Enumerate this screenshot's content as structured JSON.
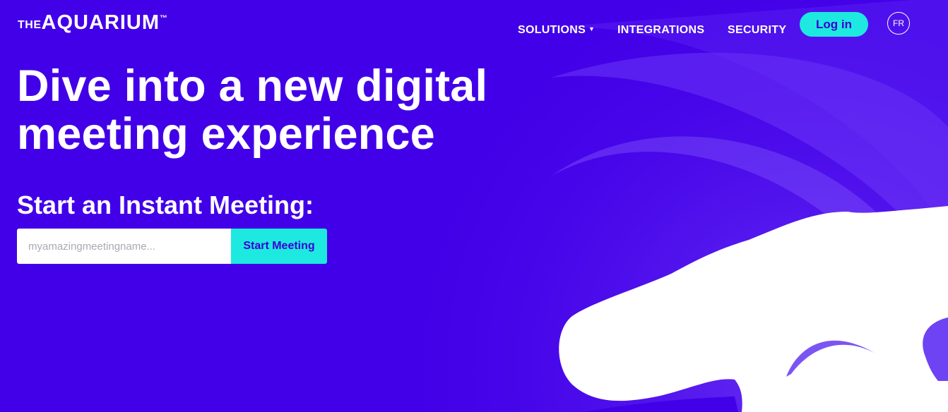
{
  "colors": {
    "background": "#4200e8",
    "accent": "#1de9e0",
    "accent_text": "#3a00d6",
    "text": "#ffffff"
  },
  "header": {
    "logo": {
      "prefix": "THE",
      "name": "AQUARIUM",
      "trademark": "™"
    },
    "nav": {
      "solutions": "SOLUTIONS",
      "integrations": "INTEGRATIONS",
      "security": "SECURITY"
    },
    "login_label": "Log in",
    "language_label": "FR"
  },
  "hero": {
    "title": "Dive into a new digital meeting experience",
    "subtitle": "Start an Instant Meeting:",
    "meeting_input": {
      "value": "",
      "placeholder": "myamazingmeetingname..."
    },
    "start_button": "Start Meeting"
  },
  "icons": {
    "dropdown_caret": "caret-down-icon"
  }
}
